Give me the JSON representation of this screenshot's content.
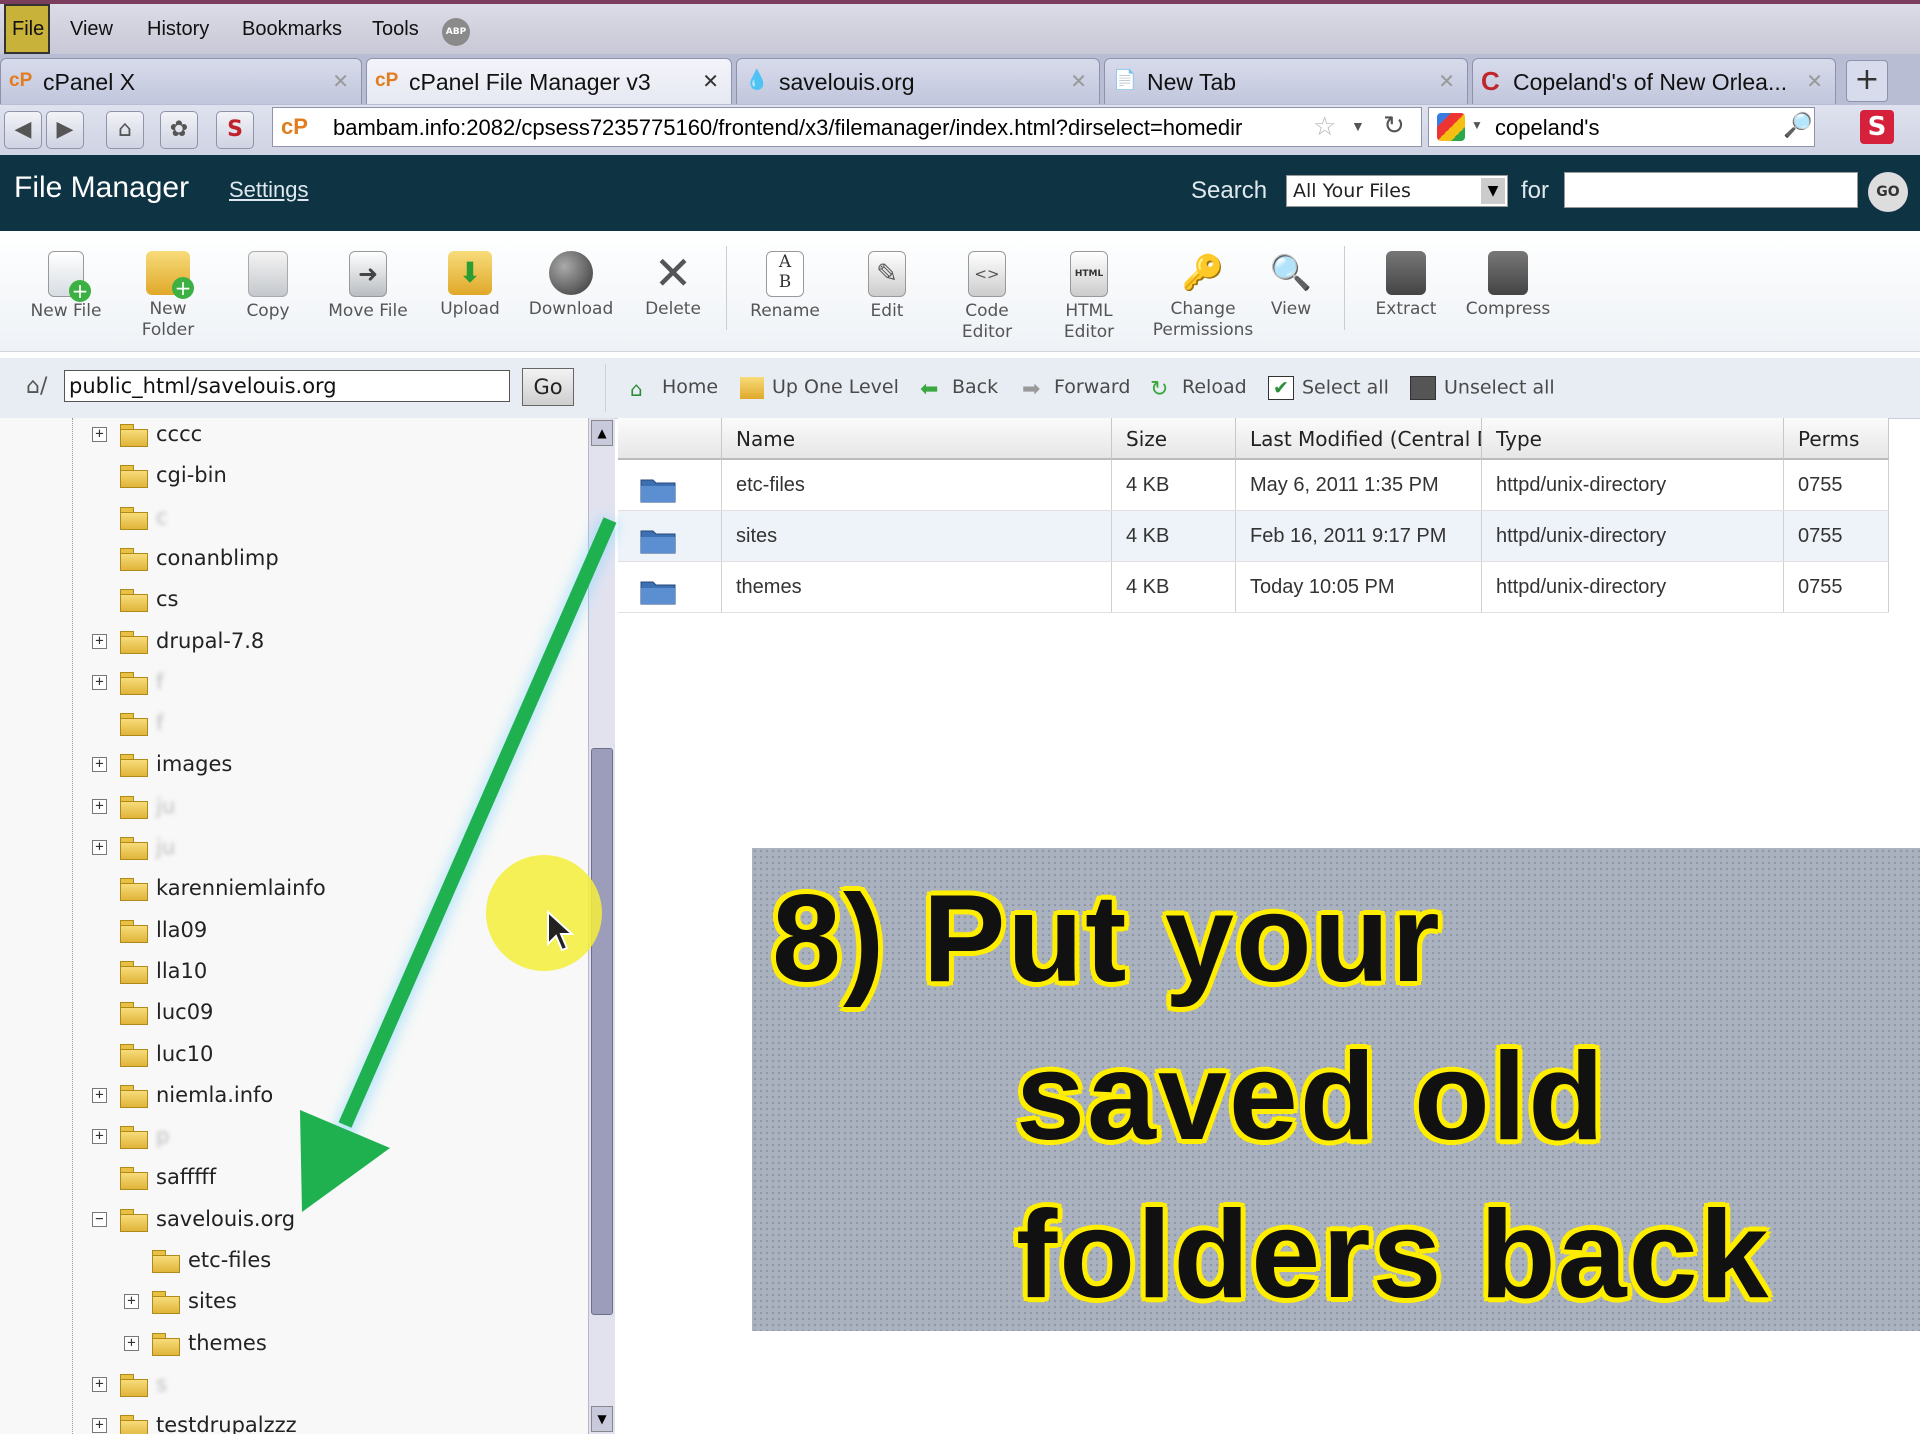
{
  "menu": [
    "File",
    "View",
    "History",
    "Bookmarks",
    "Tools"
  ],
  "menu_extra": "ABP",
  "tabs": [
    {
      "label": "cPanel X",
      "icon": "cP"
    },
    {
      "label": "cPanel File Manager v3",
      "icon": "cP"
    },
    {
      "label": "savelouis.org",
      "icon": "drupal"
    },
    {
      "label": "New Tab",
      "icon": "page"
    },
    {
      "label": "Copeland's of New Orlea...",
      "icon": "C"
    }
  ],
  "nav": {
    "url": "bambam.info:2082/cpsess7235775160/frontend/x3/filemanager/index.html?dirselect=homedir",
    "search": "copeland's"
  },
  "header": {
    "title": "File Manager",
    "settings": "Settings",
    "search_label": "Search",
    "search_select": "All Your Files",
    "for_label": "for",
    "go": "GO"
  },
  "toolbar": [
    {
      "label": "New File",
      "icon": "new-file"
    },
    {
      "label": "New Folder",
      "icon": "new-folder"
    },
    {
      "label": "Copy",
      "icon": "copy"
    },
    {
      "label": "Move File",
      "icon": "move-file"
    },
    {
      "label": "Upload",
      "icon": "upload"
    },
    {
      "label": "Download",
      "icon": "download"
    },
    {
      "label": "Delete",
      "icon": "delete"
    },
    {
      "label": "Rename",
      "icon": "rename"
    },
    {
      "label": "Edit",
      "icon": "edit"
    },
    {
      "label": "Code Editor",
      "icon": "code-editor"
    },
    {
      "label": "HTML Editor",
      "icon": "html-editor"
    },
    {
      "label": "Change Permissions",
      "icon": "permissions"
    },
    {
      "label": "View",
      "icon": "view"
    },
    {
      "label": "Extract",
      "icon": "extract"
    },
    {
      "label": "Compress",
      "icon": "compress"
    }
  ],
  "path": {
    "value": "public_html/savelouis.org",
    "go": "Go"
  },
  "navlinks": [
    "Home",
    "Up One Level",
    "Back",
    "Forward",
    "Reload",
    "Select all",
    "Unselect all"
  ],
  "tree": [
    {
      "label": "cccc",
      "expander": "+",
      "level": 0
    },
    {
      "label": "cgi-bin",
      "expander": "",
      "level": 0
    },
    {
      "label": "c",
      "expander": "",
      "level": 0,
      "blurred": true
    },
    {
      "label": "conanblimp",
      "expander": "",
      "level": 0
    },
    {
      "label": "cs",
      "expander": "",
      "level": 0
    },
    {
      "label": "drupal-7.8",
      "expander": "+",
      "level": 0
    },
    {
      "label": "f",
      "expander": "+",
      "level": 0,
      "blurred": true
    },
    {
      "label": "f",
      "expander": "",
      "level": 0,
      "blurred": true
    },
    {
      "label": "images",
      "expander": "+",
      "level": 0
    },
    {
      "label": "ju",
      "expander": "+",
      "level": 0,
      "blurred": true
    },
    {
      "label": "ju",
      "expander": "+",
      "level": 0,
      "blurred": true
    },
    {
      "label": "karenniemlainfo",
      "expander": "",
      "level": 0
    },
    {
      "label": "lla09",
      "expander": "",
      "level": 0
    },
    {
      "label": "lla10",
      "expander": "",
      "level": 0
    },
    {
      "label": "luc09",
      "expander": "",
      "level": 0
    },
    {
      "label": "luc10",
      "expander": "",
      "level": 0
    },
    {
      "label": "niemla.info",
      "expander": "+",
      "level": 0
    },
    {
      "label": "p",
      "expander": "+",
      "level": 0,
      "blurred": true
    },
    {
      "label": "safffff",
      "expander": "",
      "level": 0
    },
    {
      "label": "savelouis.org",
      "expander": "−",
      "level": 0,
      "open": true
    },
    {
      "label": "etc-files",
      "expander": "",
      "level": 1
    },
    {
      "label": "sites",
      "expander": "+",
      "level": 1
    },
    {
      "label": "themes",
      "expander": "+",
      "level": 1
    },
    {
      "label": "s",
      "expander": "+",
      "level": 0,
      "blurred": true
    },
    {
      "label": "testdrupalzzz",
      "expander": "+",
      "level": 0
    }
  ],
  "table": {
    "headers": [
      "Name",
      "Size",
      "Last Modified (Central Da",
      "Type",
      "Perms"
    ],
    "rows": [
      {
        "name": "etc-files",
        "size": "4 KB",
        "modified": "May 6, 2011 1:35 PM",
        "type": "httpd/unix-directory",
        "perms": "0755"
      },
      {
        "name": "sites",
        "size": "4 KB",
        "modified": "Feb 16, 2011 9:17 PM",
        "type": "httpd/unix-directory",
        "perms": "0755"
      },
      {
        "name": "themes",
        "size": "4 KB",
        "modified": "Today 10:05 PM",
        "type": "httpd/unix-directory",
        "perms": "0755"
      }
    ]
  },
  "overlay": {
    "line1": "8) Put your",
    "line2": "saved old",
    "line3": "folders back"
  },
  "colors": {
    "header_bg": "#0e3444",
    "arrow": "#1fb050",
    "highlight": "#f4ee3a"
  }
}
